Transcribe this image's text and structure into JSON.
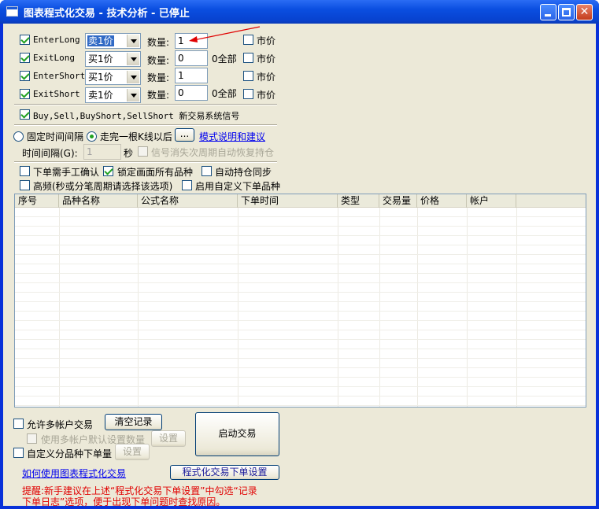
{
  "window": {
    "title": "图表程式化交易 - 技术分析 - 已停止"
  },
  "signals": [
    {
      "name": "EnterLong",
      "checked": true,
      "price": "卖1价",
      "qty_label": "数量:",
      "qty": "1",
      "all_label": "",
      "market_label": "市价"
    },
    {
      "name": "ExitLong",
      "checked": true,
      "price": "买1价",
      "qty_label": "数量:",
      "qty": "0",
      "all_label": "0全部",
      "market_label": "市价"
    },
    {
      "name": "EnterShort",
      "checked": true,
      "price": "买1价",
      "qty_label": "数量:",
      "qty": "1",
      "all_label": "",
      "market_label": "市价"
    },
    {
      "name": "ExitShort",
      "checked": true,
      "price": "卖1价",
      "qty_label": "数量:",
      "qty": "0",
      "all_label": "0全部",
      "market_label": "市价"
    }
  ],
  "new_signal": {
    "label": "Buy,Sell,BuyShort,SellShort 新交易系统信号"
  },
  "timing": {
    "fixed_interval": "固定时间间隔",
    "after_kline": "走完一根K线以后",
    "ellipsis_button": "...",
    "mode_link": "模式说明和建议",
    "interval_label": "时间间隔(G):",
    "interval_value": "1",
    "seconds_label": "秒",
    "recover_label": "信号消失次周期自动恢复持仓"
  },
  "options": {
    "manual_confirm": "下单需手工确认",
    "lock_all": "锁定画面所有品种",
    "auto_sync": "自动持仓同步",
    "high_freq": "高频(秒或分笔周期请选择该选项)",
    "custom_symbol": "启用自定义下单品种"
  },
  "table": {
    "columns": [
      "序号",
      "品种名称",
      "公式名称",
      "下单时间",
      "类型",
      "交易量",
      "价格",
      "帐户"
    ],
    "rows": []
  },
  "bottom": {
    "multi_account": "允许多帐户交易",
    "clear_records": "清空记录",
    "use_default_qty": "使用多帐户默认设置数量",
    "settings1": "设置",
    "custom_qty": "自定义分品种下单量",
    "settings2": "设置",
    "start_trading": "启动交易",
    "howto_link": "如何使用图表程式化交易",
    "order_settings": "程式化交易下单设置",
    "tip_line1": "提醒:新手建议在上述“程式化交易下单设置”中勾选“记录",
    "tip_line2": "下单日志”选项，便于出现下单问题时查找原因。"
  },
  "colors": {
    "titlebar": "#0a4ee0",
    "dialog_bg": "#ece9d8",
    "selection": "#316ac5",
    "arrow": "#e00000",
    "tip_text": "#e00000"
  }
}
